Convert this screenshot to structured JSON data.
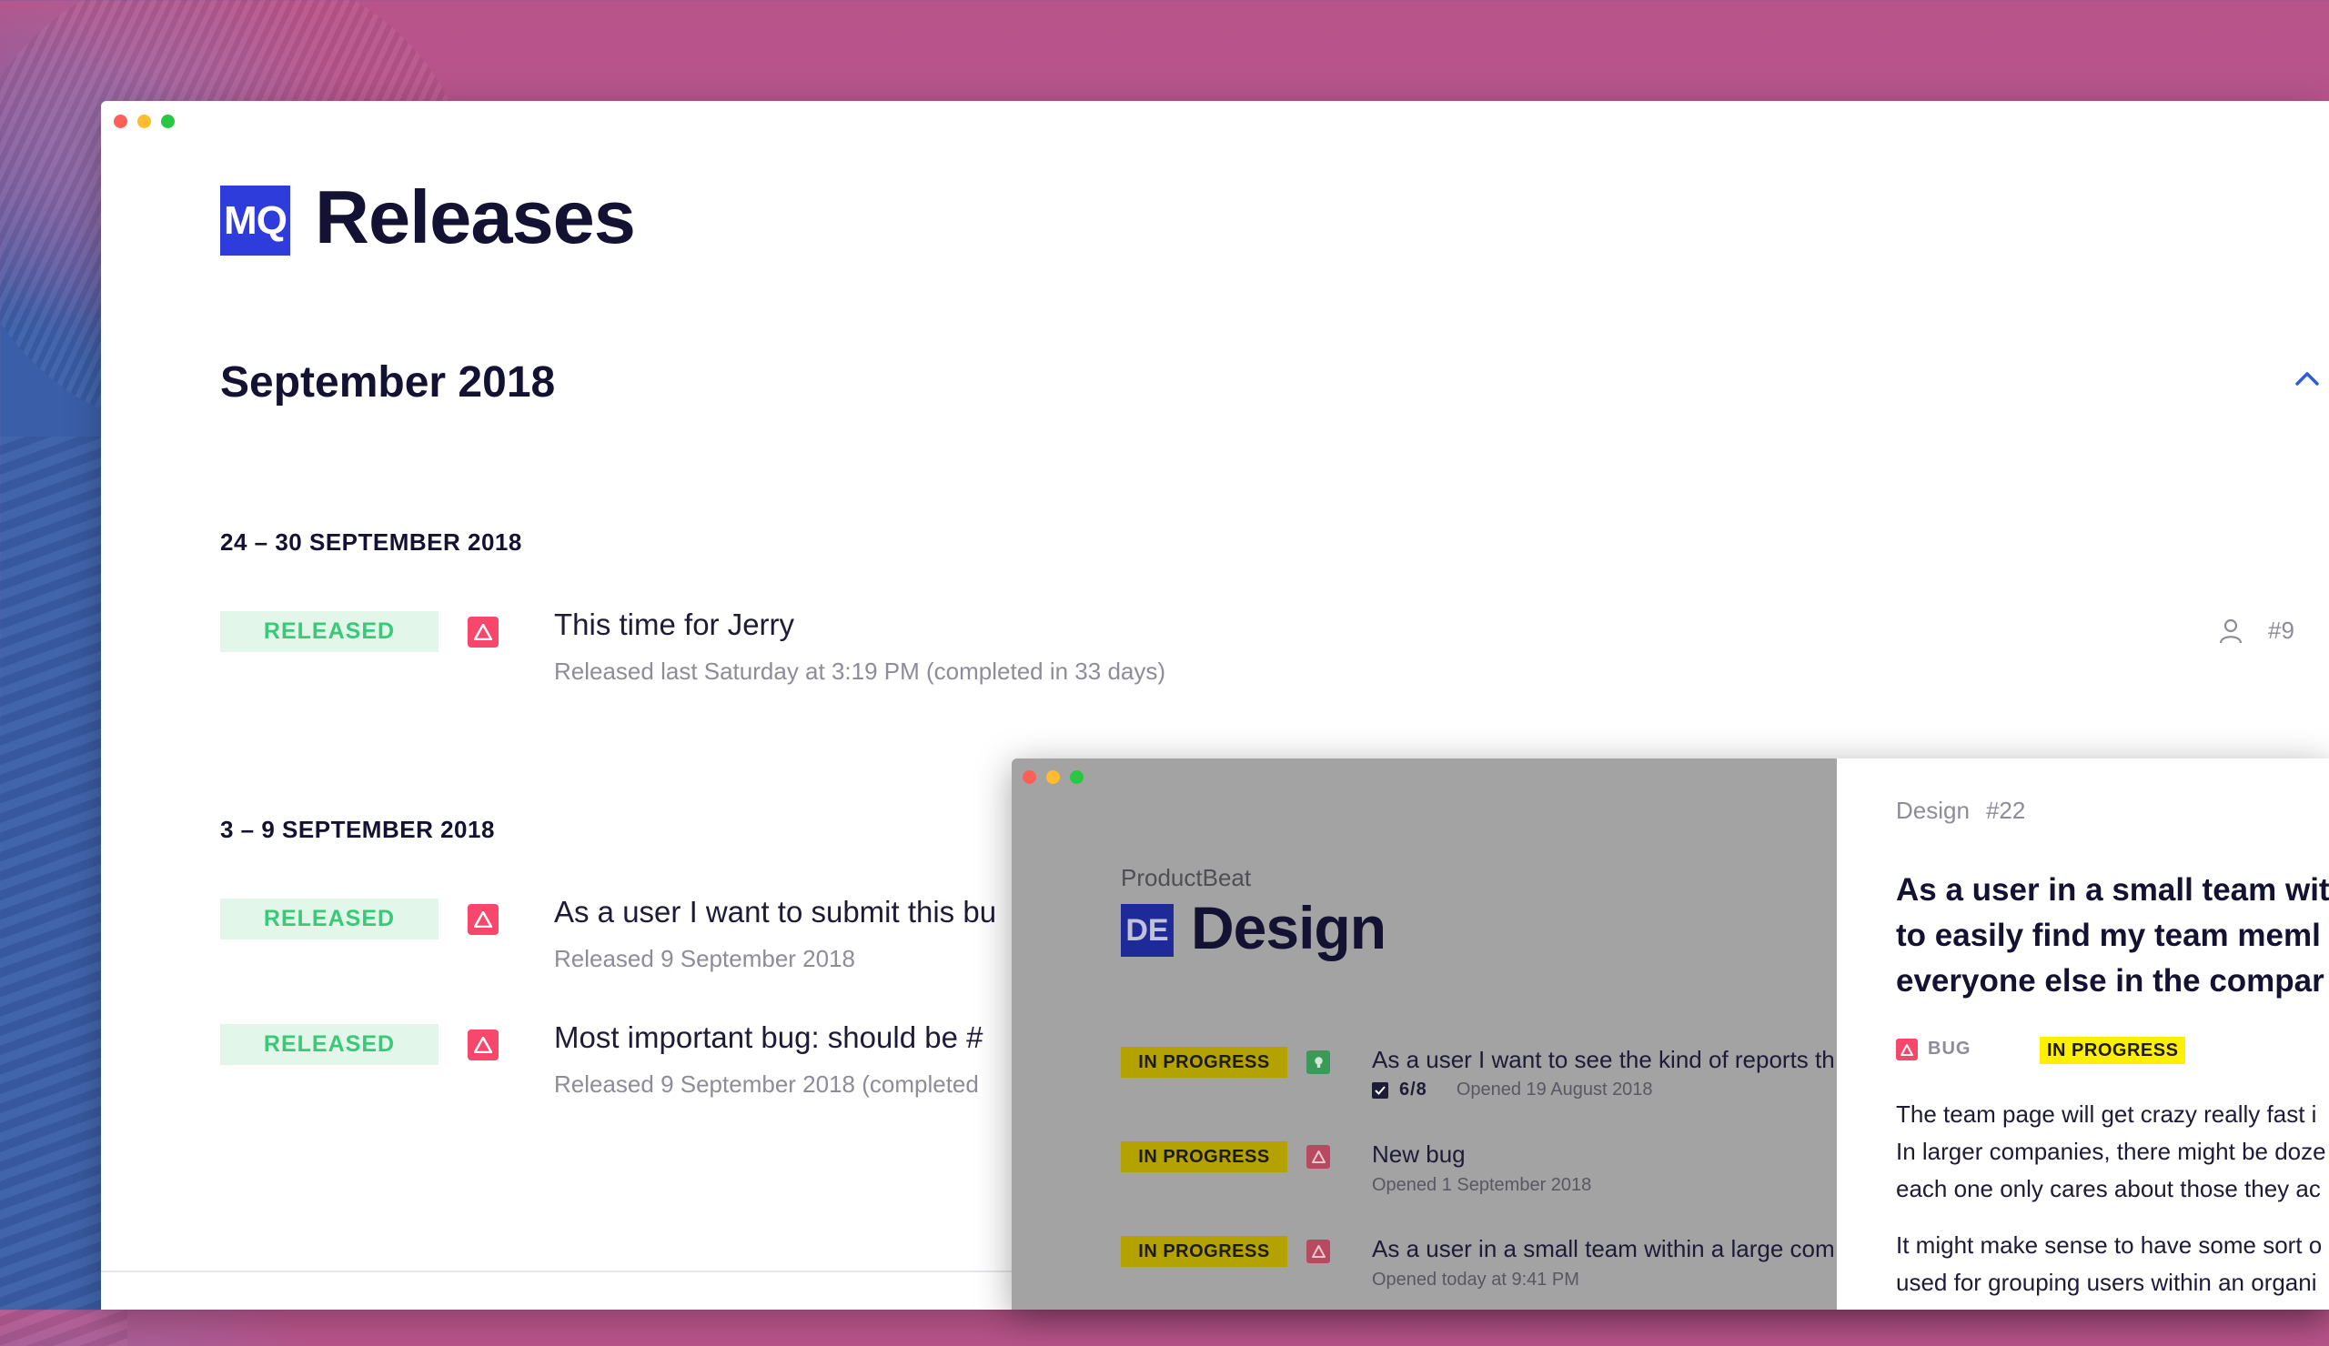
{
  "main": {
    "logo_text": "MQ",
    "page_title": "Releases",
    "month_title": "September 2018",
    "weeks": [
      {
        "header": "24 – 30 SEPTEMBER 2018",
        "releases": [
          {
            "status": "RELEASED",
            "title": "This time for Jerry",
            "subtitle": "Released last Saturday at 3:19 PM (completed in 33 days)",
            "issue_number": "#9"
          }
        ]
      },
      {
        "header": "3 – 9 SEPTEMBER 2018",
        "releases": [
          {
            "status": "RELEASED",
            "title": "As a user I want to submit this bu",
            "subtitle": "Released 9 September 2018"
          },
          {
            "status": "RELEASED",
            "title": "Most important bug: should be #",
            "subtitle": "Released 9 September 2018 (completed"
          }
        ]
      }
    ]
  },
  "overlay": {
    "project_name": "ProductBeat",
    "logo_text": "DE",
    "title": "Design",
    "issues": [
      {
        "status": "IN PROGRESS",
        "type_icon": "lightbulb-icon",
        "title": "As a user I want to see the kind of reports th",
        "subtasks": "6/8",
        "opened": "Opened 19 August 2018"
      },
      {
        "status": "IN PROGRESS",
        "type_icon": "bug-icon",
        "title": "New bug",
        "opened": "Opened 1 September 2018"
      },
      {
        "status": "IN PROGRESS",
        "type_icon": "bug-icon",
        "title": "As a user in a small team within a large com",
        "opened": "Opened today at 9:41 PM"
      }
    ],
    "detail": {
      "breadcrumb": "Design",
      "issue_number": "#22",
      "title_lines": [
        "As a user in a small team wit",
        "to easily find my team meml",
        "everyone else in the compar"
      ],
      "type_label": "BUG",
      "status": "IN PROGRESS",
      "body_paragraphs": [
        [
          "The team page will get crazy really fast i",
          "In larger companies, there might be doze",
          "each one only cares about those they ac"
        ],
        [
          "It might make sense to have some sort o",
          "used for grouping users within an organi"
        ]
      ]
    }
  },
  "colors": {
    "brand_blue": "#2e3cdb",
    "released_bg": "#e2f7ea",
    "released_text": "#39c978",
    "bug_red": "#f9466b",
    "in_progress_yellow": "#fff000"
  }
}
